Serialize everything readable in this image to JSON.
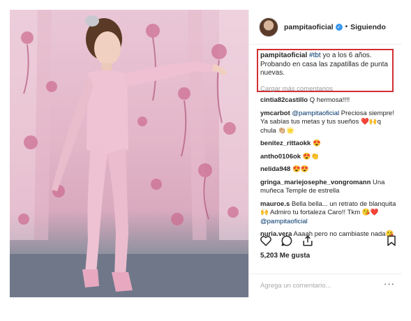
{
  "post": {
    "username": "pampitaoficial",
    "follow_label": "Siguiendo",
    "dot": "•",
    "verified_mark": "✓"
  },
  "caption": {
    "username": "pampitaoficial",
    "hashtag": "#tbt",
    "text": " yo a los 6 años. Probando en casa las zapatillas de punta nuevas."
  },
  "load_more": "Cargar más comentarios",
  "comments": [
    {
      "user": "cintia82castillo",
      "text": " Q hermosa!!!!"
    },
    {
      "user": "ymcarbot",
      "mention": " @pampitaoficial",
      "text": " Preciosa siempre! Ya sabías tus metas y tus sueños ❤️🙌q chula 👏🏼🌟"
    },
    {
      "user": "benitez_rittaokk",
      "text": " 😍"
    },
    {
      "user": "antho0106ok",
      "text": " 😍👏"
    },
    {
      "user": "nelida948",
      "text": " 😍😍"
    },
    {
      "user": "gringa_mariejosephe_vongromann",
      "text": " Una muñeca Temple de estrella"
    },
    {
      "user": "mauroe.s",
      "text": " Bella bella... un retrato de blanquita 🙌 Admiro tu fortaleza Caro!! Tkm 😘❤️",
      "mention": " @pampitaoficial"
    },
    {
      "user": "nuria.vera",
      "text": " Aaaah pero no cambiaste nada😘"
    }
  ],
  "likes": "5,203 Me gusta",
  "add_comment_placeholder": "Agrega un comentario...",
  "more_options": "···",
  "icons": {
    "like": "heart-icon",
    "comment": "comment-icon",
    "share": "share-icon",
    "save": "bookmark-icon"
  },
  "colors": {
    "highlight_box": "#d22f33",
    "verified": "#3897f0",
    "mention": "#003569"
  }
}
